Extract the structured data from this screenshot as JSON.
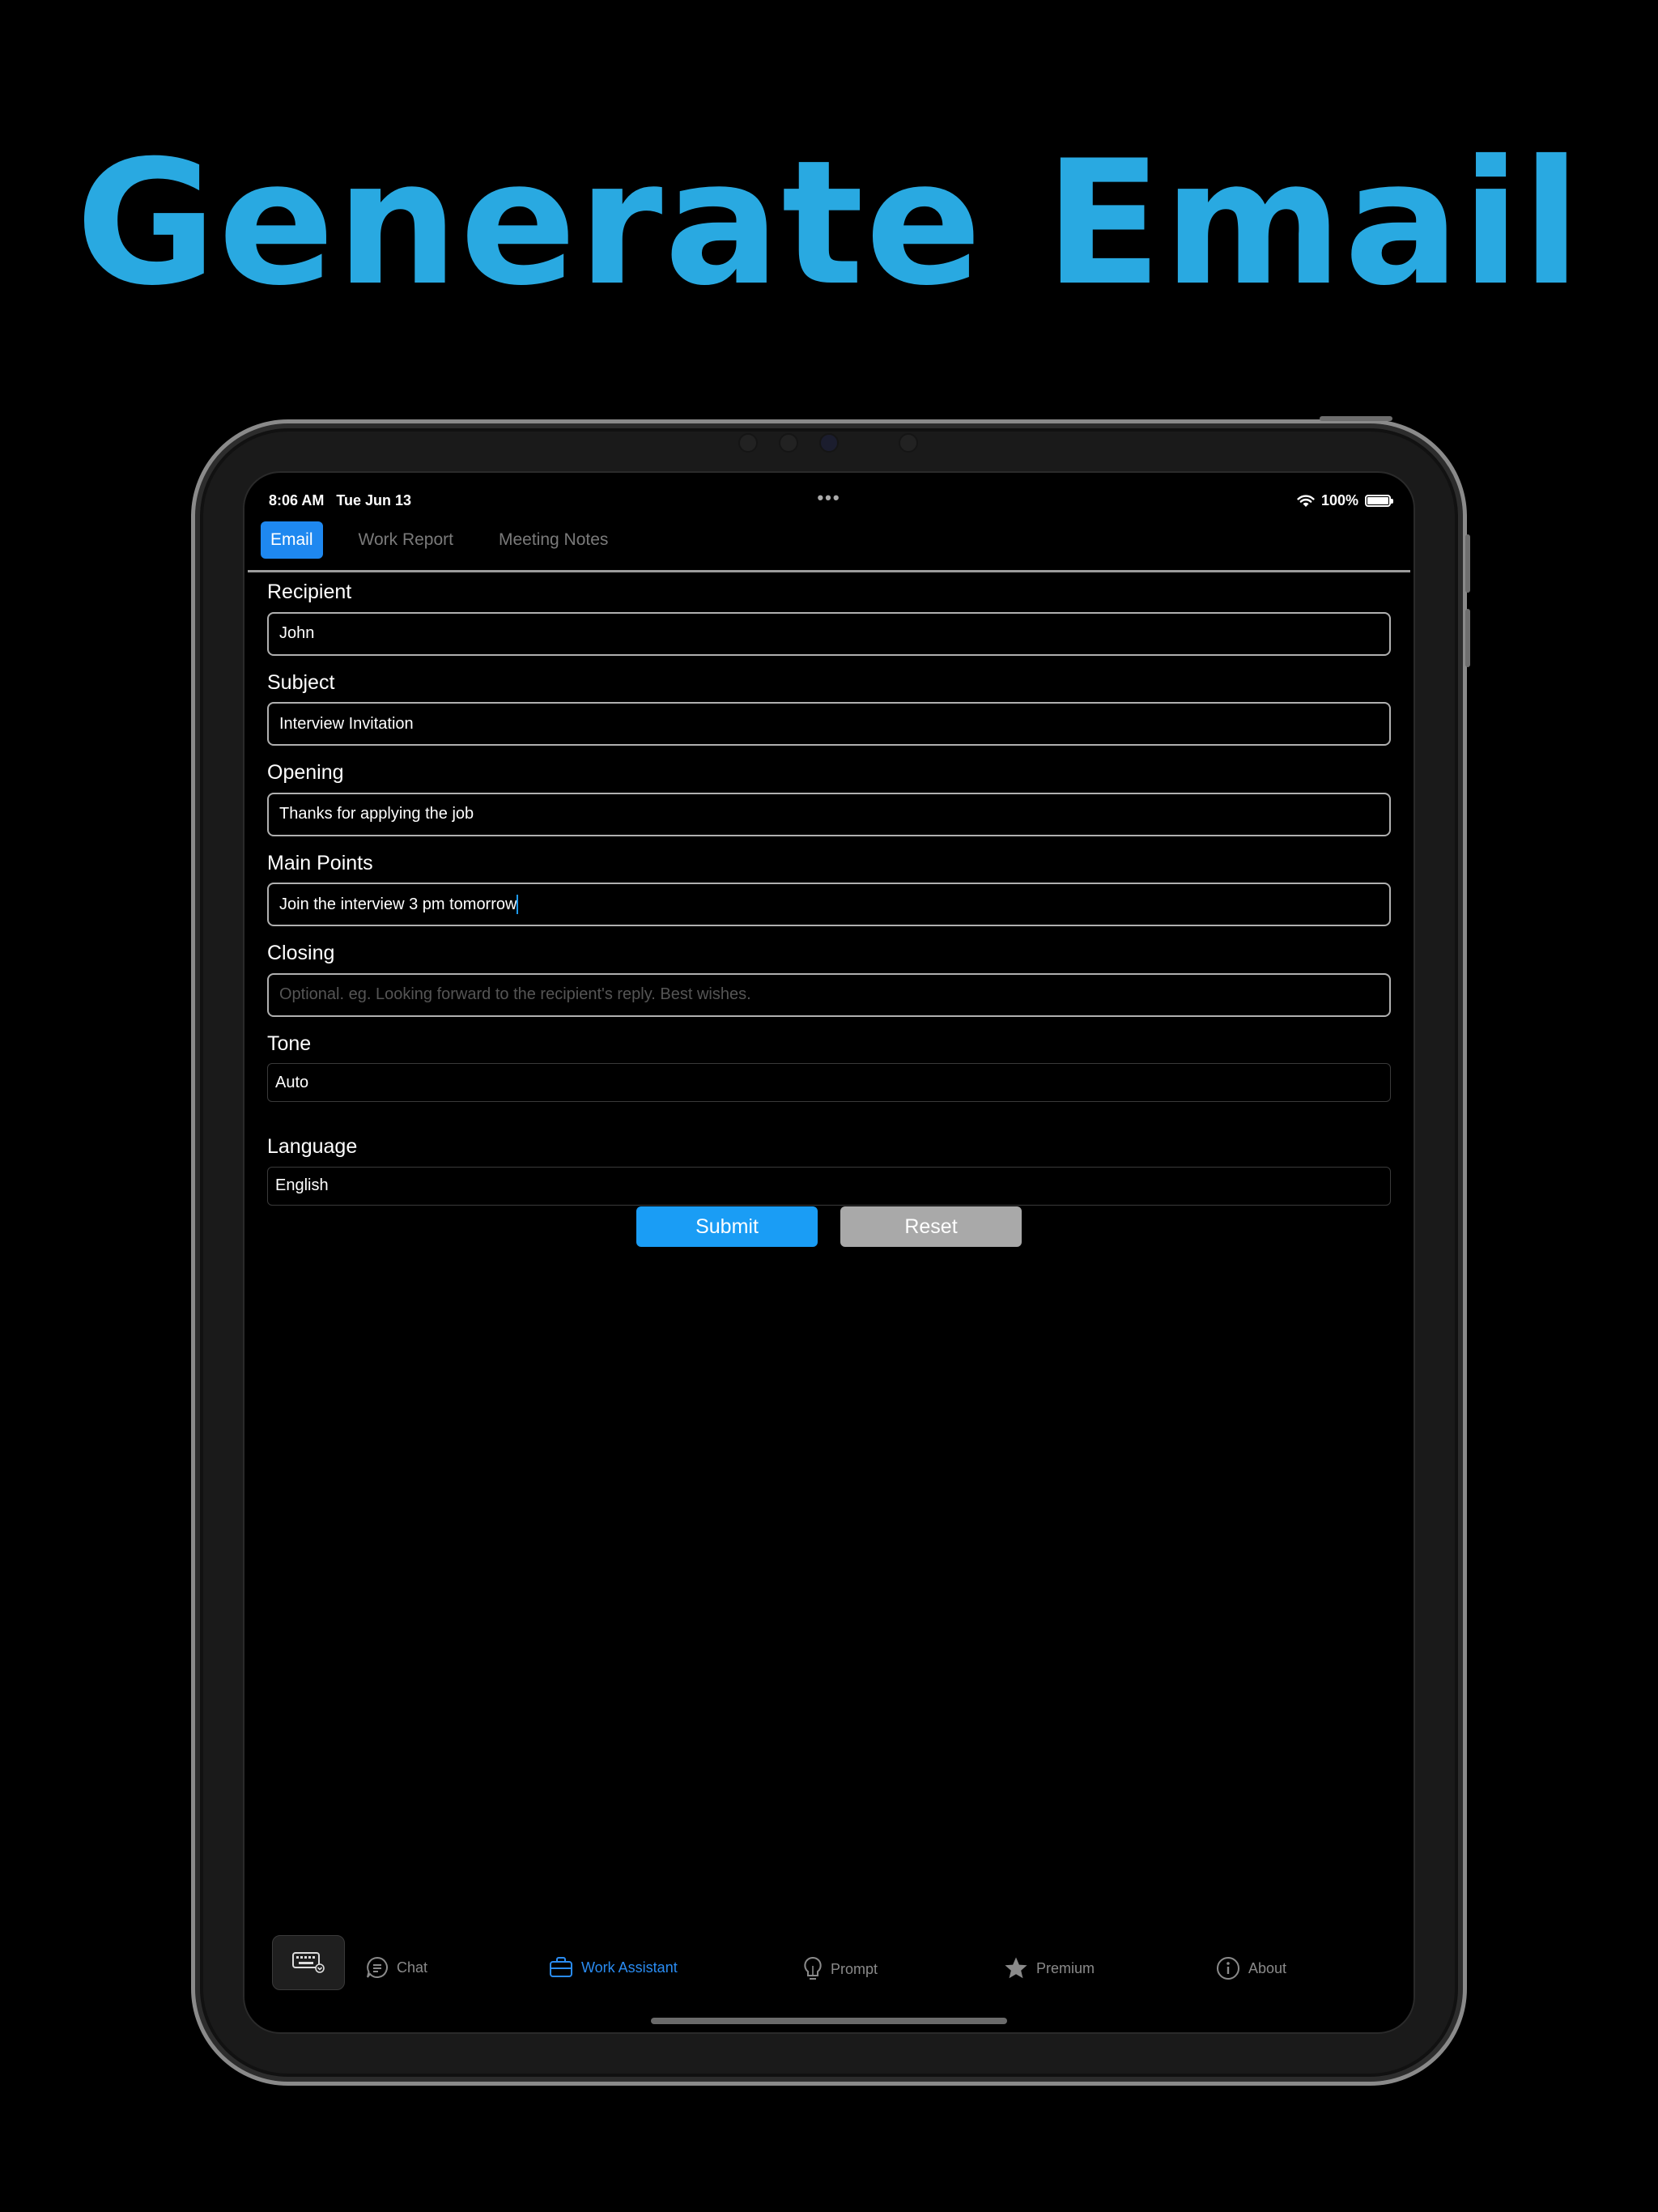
{
  "headline": {
    "text": "Generate Email",
    "color": "#29a9e1"
  },
  "status": {
    "time": "8:06 AM   Tue Jun 13",
    "dots": "•••",
    "battery": "100%"
  },
  "tabs": [
    {
      "label": "Email",
      "active": true
    },
    {
      "label": "Work Report",
      "active": false
    },
    {
      "label": "Meeting Notes",
      "active": false
    }
  ],
  "form": {
    "recipient": {
      "label": "Recipient",
      "value": "John"
    },
    "subject": {
      "label": "Subject",
      "value": "Interview Invitation"
    },
    "opening": {
      "label": "Opening",
      "value": "Thanks for applying the job"
    },
    "main_points": {
      "label": "Main Points",
      "value": "Join the interview 3 pm tomorrow"
    },
    "closing": {
      "label": "Closing",
      "value": "",
      "placeholder": "Optional. eg. Looking forward to the recipient's reply. Best wishes."
    },
    "tone": {
      "label": "Tone",
      "value": "Auto"
    },
    "language": {
      "label": "Language",
      "value": "English"
    }
  },
  "buttons": {
    "submit": "Submit",
    "reset": "Reset"
  },
  "bottom_nav": {
    "chat": "Chat",
    "work_assistant": "Work Assistant",
    "prompt": "Prompt",
    "premium": "Premium",
    "about": "About"
  },
  "colors": {
    "accent": "#1e88f0",
    "submit": "#1a9df5",
    "reset": "#a9a9a9",
    "nav_active": "#2a8cf2"
  }
}
